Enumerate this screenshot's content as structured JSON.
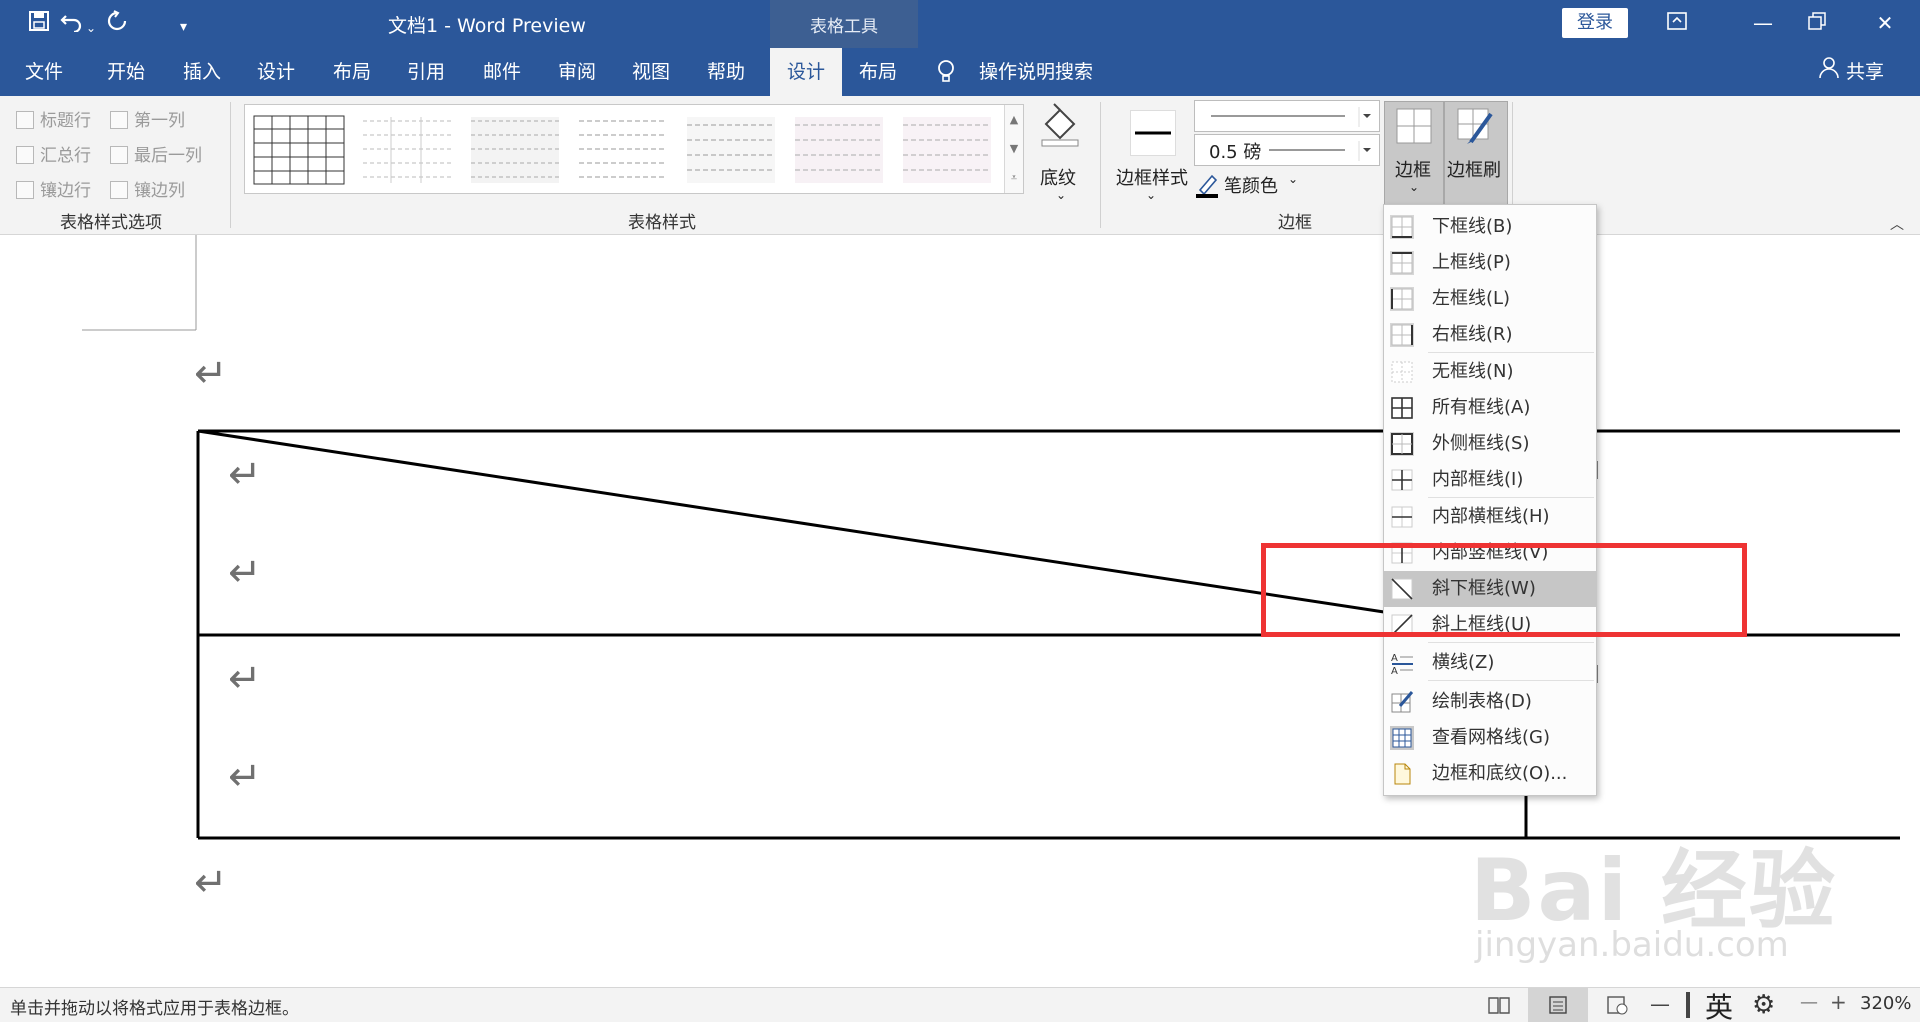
{
  "titlebar": {
    "doc_title": "文档1  -  Word Preview",
    "contextual_tab": "表格工具",
    "login": "登录"
  },
  "menu": {
    "tabs": [
      "文件",
      "开始",
      "插入",
      "设计",
      "布局",
      "引用",
      "邮件",
      "审阅",
      "视图",
      "帮助",
      "设计",
      "布局"
    ],
    "active_index": 10,
    "search": "操作说明搜索",
    "share": "共享"
  },
  "ribbon": {
    "options": {
      "items": [
        "标题行",
        "第一列",
        "汇总行",
        "最后一列",
        "镶边行",
        "镶边列"
      ],
      "group_label": "表格样式选项"
    },
    "styles_group_label": "表格样式",
    "shading_label": "底纹",
    "border_styles_label": "边框样式",
    "pen_weight": "0.5 磅",
    "pen_color_label": "笔颜色",
    "borders_group_label": "边框",
    "borders_button": "边框",
    "border_painter_button": "边框刷"
  },
  "border_menu": {
    "items": [
      {
        "label": "下框线(B)",
        "icon": "bottom-border-icon"
      },
      {
        "label": "上框线(P)",
        "icon": "top-border-icon"
      },
      {
        "label": "左框线(L)",
        "icon": "left-border-icon"
      },
      {
        "label": "右框线(R)",
        "icon": "right-border-icon"
      },
      {
        "label": "无框线(N)",
        "icon": "no-border-icon"
      },
      {
        "label": "所有框线(A)",
        "icon": "all-borders-icon"
      },
      {
        "label": "外侧框线(S)",
        "icon": "outside-borders-icon"
      },
      {
        "label": "内部框线(I)",
        "icon": "inside-borders-icon"
      },
      {
        "label": "内部横框线(H)",
        "icon": "inside-horizontal-border-icon"
      },
      {
        "label": "内部竖框线(V)",
        "icon": "inside-vertical-border-icon"
      },
      {
        "label": "斜下框线(W)",
        "icon": "diagonal-down-border-icon"
      },
      {
        "label": "斜上框线(U)",
        "icon": "diagonal-up-border-icon"
      },
      {
        "label": "横线(Z)",
        "icon": "horizontal-line-icon"
      },
      {
        "label": "绘制表格(D)",
        "icon": "draw-table-icon"
      },
      {
        "label": "查看网格线(G)",
        "icon": "view-gridlines-icon"
      },
      {
        "label": "边框和底纹(O)...",
        "icon": "borders-shading-icon"
      }
    ],
    "highlighted_index": 10
  },
  "status": {
    "text": "单击并拖动以将格式应用于表格边框。",
    "ime": "英",
    "zoom": "320%"
  },
  "watermark": {
    "brand": "Bai  经验",
    "url": "jingyan.baidu.com"
  }
}
